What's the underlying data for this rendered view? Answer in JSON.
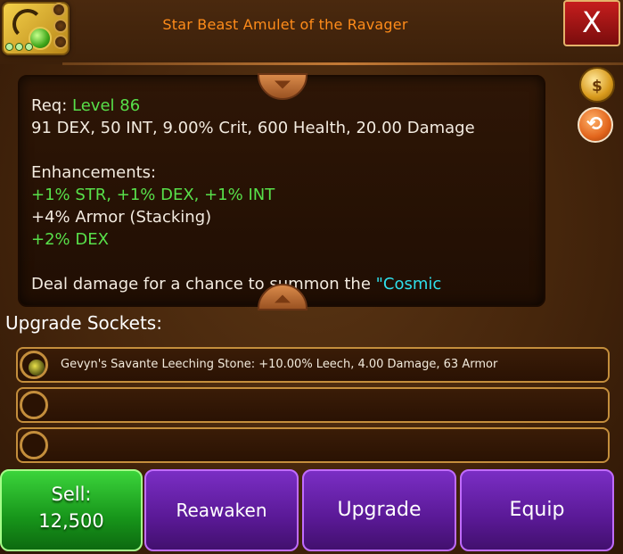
{
  "header": {
    "title": "Star Beast Amulet of the Ravager",
    "close_label": "X"
  },
  "description": {
    "req_label": "Req:",
    "req_value": "Level 86",
    "stats": "91 DEX, 50 INT, 9.00% Crit, 600 Health, 20.00 Damage",
    "enhancements_heading": "Enhancements:",
    "enhancement_lines": [
      "+1% STR, +1% DEX, +1% INT",
      "+4% Armor (Stacking)",
      "+2% DEX"
    ],
    "effect_text": "Deal damage for a chance to summon the ",
    "effect_highlight": "\"Cosmic"
  },
  "sockets": {
    "label": "Upgrade Sockets:",
    "rows": [
      "Gevyn's Savante Leeching Stone: +10.00% Leech, 4.00 Damage, 63 Armor",
      "",
      ""
    ]
  },
  "buttons": {
    "sell_label": "Sell:",
    "sell_price": "12,500",
    "reawaken": "Reawaken",
    "upgrade": "Upgrade",
    "equip": "Equip"
  },
  "icons": {
    "gold_bag": "$"
  },
  "colors": {
    "title": "#ff8c1a",
    "green": "#58e04a",
    "cyan": "#2fe0ec",
    "close": "#c61d1d",
    "sell": "#17951a",
    "action": "#5a1996"
  }
}
